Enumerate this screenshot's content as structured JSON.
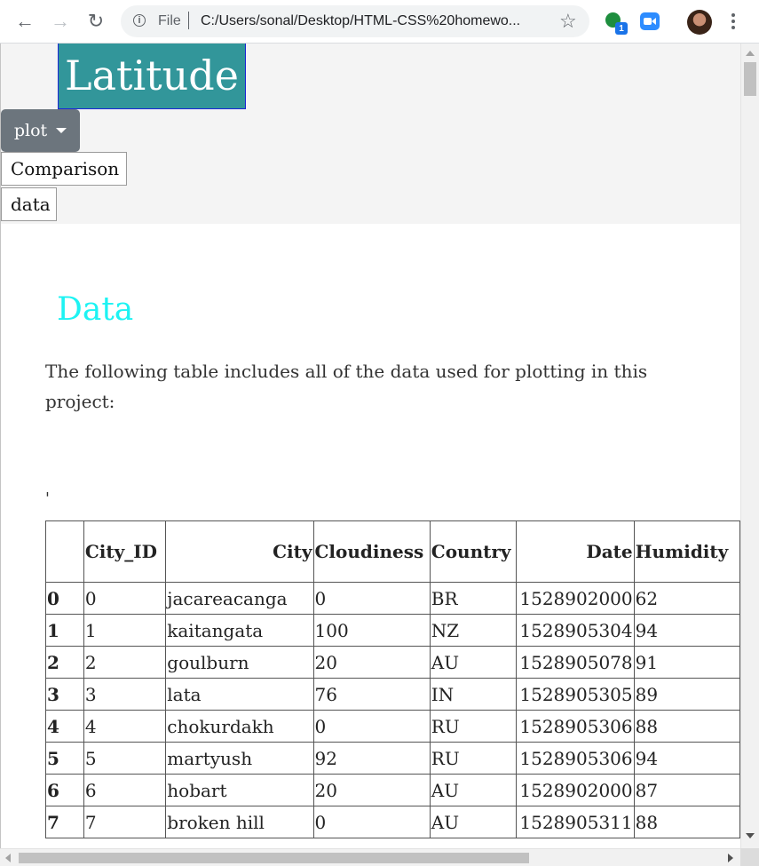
{
  "browser": {
    "url_scheme": "File",
    "url": "C:/Users/sonal/Desktop/HTML-CSS%20homewo...",
    "extension_badge": "1"
  },
  "page": {
    "brand": "Latitude",
    "plot_menu_label": "plot",
    "nav_comparison": "Comparison",
    "nav_data": "data",
    "section_title": "Data",
    "intro": "The following table includes all of the data used for plotting in this project:",
    "stray_char": "'"
  },
  "table": {
    "headers": [
      "",
      "City_ID",
      "City",
      "Cloudiness",
      "Country",
      "Date",
      "Humidity"
    ],
    "rows": [
      [
        "0",
        "0",
        "jacareacanga",
        "0",
        "BR",
        "1528902000",
        "62"
      ],
      [
        "1",
        "1",
        "kaitangata",
        "100",
        "NZ",
        "1528905304",
        "94"
      ],
      [
        "2",
        "2",
        "goulburn",
        "20",
        "AU",
        "1528905078",
        "91"
      ],
      [
        "3",
        "3",
        "lata",
        "76",
        "IN",
        "1528905305",
        "89"
      ],
      [
        "4",
        "4",
        "chokurdakh",
        "0",
        "RU",
        "1528905306",
        "88"
      ],
      [
        "5",
        "5",
        "martyush",
        "92",
        "RU",
        "1528905306",
        "94"
      ],
      [
        "6",
        "6",
        "hobart",
        "20",
        "AU",
        "1528902000",
        "87"
      ],
      [
        "7",
        "7",
        "broken hill",
        "0",
        "AU",
        "1528905311",
        "88"
      ]
    ]
  }
}
